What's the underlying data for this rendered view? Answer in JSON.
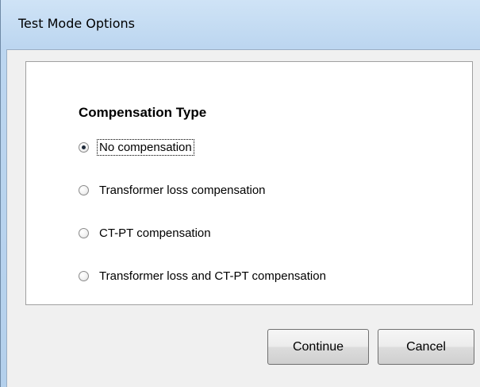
{
  "window": {
    "title": "Test Mode Options"
  },
  "group": {
    "title": "Compensation Type",
    "options": [
      {
        "label": "No compensation",
        "selected": true
      },
      {
        "label": "Transformer loss compensation",
        "selected": false
      },
      {
        "label": "CT-PT compensation",
        "selected": false
      },
      {
        "label": "Transformer loss and CT-PT compensation",
        "selected": false
      }
    ]
  },
  "buttons": {
    "continue_label": "Continue",
    "cancel_label": "Cancel"
  }
}
